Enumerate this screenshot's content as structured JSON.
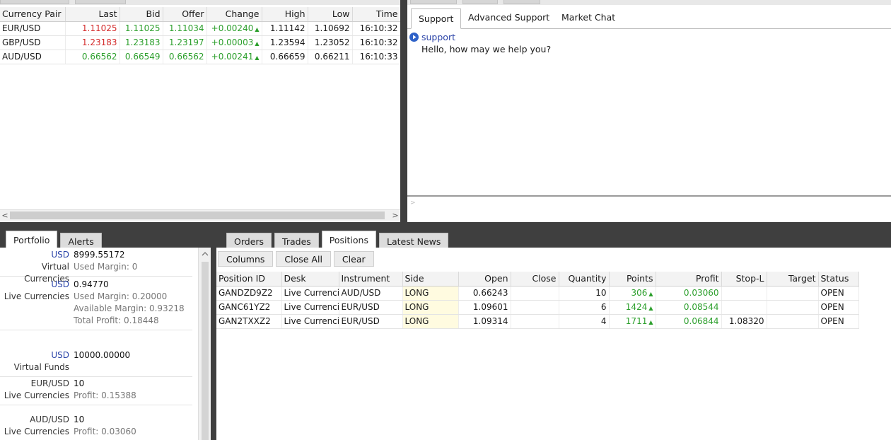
{
  "quotes": {
    "columns": [
      "Currency Pair",
      "Last",
      "Bid",
      "Offer",
      "Change",
      "High",
      "Low",
      "Time"
    ],
    "rows": [
      {
        "pair": "EUR/USD",
        "last": "1.11025",
        "bid": "1.11025",
        "offer": "1.11034",
        "change": "+0.00240",
        "high": "1.11142",
        "low": "1.10692",
        "time": "16:10:32"
      },
      {
        "pair": "GBP/USD",
        "last": "1.23183",
        "bid": "1.23183",
        "offer": "1.23197",
        "change": "+0.00003",
        "high": "1.23594",
        "low": "1.23052",
        "time": "16:10:32"
      },
      {
        "pair": "AUD/USD",
        "last": "0.66562",
        "bid": "0.66549",
        "offer": "0.66562",
        "change": "+0.00241",
        "high": "0.66659",
        "low": "0.66211",
        "time": "16:10:33"
      }
    ],
    "up_glyph": "▲",
    "scroll_left": "<",
    "scroll_right": ">"
  },
  "chat": {
    "tabs": [
      "Support",
      "Advanced Support",
      "Market Chat"
    ],
    "sender": "support",
    "message": "Hello, how may we help you?",
    "input_prompt": ">"
  },
  "left_tabs": [
    "Portfolio",
    "Alerts"
  ],
  "portfolio": [
    {
      "currency": "USD",
      "amount": "8999.55172",
      "name": "Virtual Currencies",
      "details": [
        "Used Margin:  0"
      ]
    },
    {
      "currency": "USD",
      "amount": "0.94770",
      "name": "Live Currencies",
      "details": [
        "Used Margin:  0.20000",
        "Available Margin:  0.93218",
        "Total Profit:  0.18448"
      ]
    },
    {
      "currency": "USD",
      "amount": "10000.00000",
      "name": "Virtual Funds",
      "details": []
    },
    {
      "currency": "EUR/USD",
      "amount": "10",
      "name": "Live Currencies",
      "details": [
        "Profit:  0.15388"
      ]
    },
    {
      "currency": "AUD/USD",
      "amount": "10",
      "name": "Live Currencies",
      "details": [
        "Profit:  0.03060"
      ]
    }
  ],
  "main_tabs": [
    "Orders",
    "Trades",
    "Positions",
    "Latest News"
  ],
  "toolbar": {
    "columns": "Columns",
    "close_all": "Close All",
    "clear": "Clear"
  },
  "positions": {
    "columns": [
      "Position ID",
      "Desk",
      "Instrument",
      "Side",
      "Open",
      "Close",
      "Quantity",
      "Points",
      "Profit",
      "Stop-L",
      "Target",
      "Status"
    ],
    "rows": [
      {
        "id": "GANDZD9Z2",
        "desk": "Live Currencies",
        "instrument": "AUD/USD",
        "side": "LONG",
        "open": "0.66243",
        "close": "",
        "quantity": "10",
        "points": "306",
        "profit": "0.03060",
        "stop": "",
        "target": "",
        "status": "OPEN"
      },
      {
        "id": "GANC61YZ2",
        "desk": "Live Currencies",
        "instrument": "EUR/USD",
        "side": "LONG",
        "open": "1.09601",
        "close": "",
        "quantity": "6",
        "points": "1424",
        "profit": "0.08544",
        "stop": "",
        "target": "",
        "status": "OPEN"
      },
      {
        "id": "GAN2TXXZ2",
        "desk": "Live Currencies",
        "instrument": "EUR/USD",
        "side": "LONG",
        "open": "1.09314",
        "close": "",
        "quantity": "4",
        "points": "1711",
        "profit": "0.06844",
        "stop": "1.08320",
        "target": "",
        "status": "OPEN"
      }
    ]
  }
}
